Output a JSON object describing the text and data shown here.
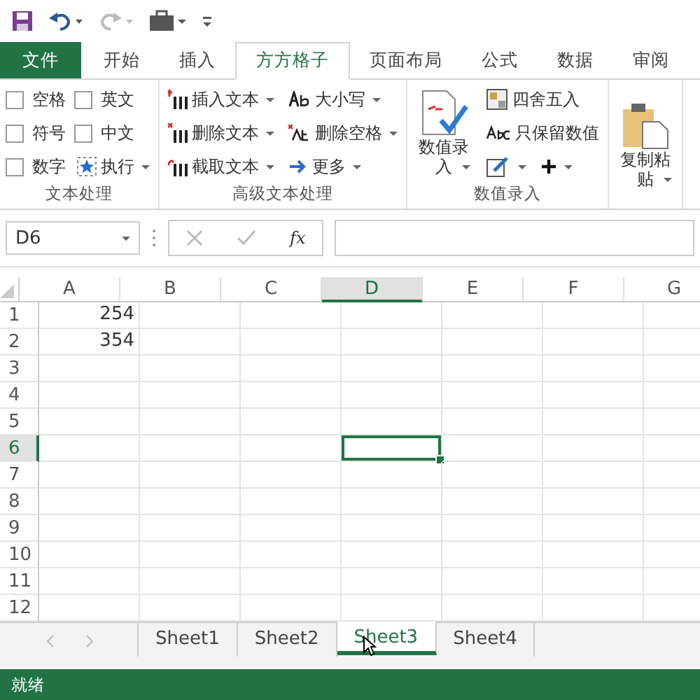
{
  "tabs": [
    {
      "label": "文件",
      "kind": "file",
      "selected": false
    },
    {
      "label": "开始",
      "kind": "tab",
      "selected": false
    },
    {
      "label": "插入",
      "kind": "tab",
      "selected": false
    },
    {
      "label": "方方格子",
      "kind": "tab",
      "selected": true
    },
    {
      "label": "页面布局",
      "kind": "tab",
      "selected": false
    },
    {
      "label": "公式",
      "kind": "tab",
      "selected": false
    },
    {
      "label": "数据",
      "kind": "tab",
      "selected": false
    },
    {
      "label": "审阅",
      "kind": "tab",
      "selected": false
    }
  ],
  "groups": [
    {
      "title": "文本处理",
      "columns": [
        [
          {
            "kind": "checkbox",
            "label": "空格",
            "checked": false
          },
          {
            "kind": "checkbox",
            "label": "符号",
            "checked": false
          },
          {
            "kind": "checkbox",
            "label": "数字",
            "checked": false
          }
        ],
        [
          {
            "kind": "checkbox",
            "label": "英文",
            "checked": false
          },
          {
            "kind": "checkbox",
            "label": "中文",
            "checked": false
          },
          {
            "kind": "button",
            "label": "执行",
            "dropdown": true
          }
        ]
      ]
    },
    {
      "title": "高级文本处理",
      "columns": [
        [
          {
            "kind": "button",
            "label": "插入文本",
            "dropdown": true
          },
          {
            "kind": "button",
            "label": "删除文本",
            "dropdown": true
          },
          {
            "kind": "button",
            "label": "截取文本",
            "dropdown": true
          }
        ],
        [
          {
            "kind": "button",
            "label": "大小写",
            "dropdown": true
          },
          {
            "kind": "button",
            "label": "删除空格",
            "dropdown": true
          },
          {
            "kind": "button",
            "label": "更多",
            "dropdown": true
          }
        ]
      ]
    },
    {
      "title": "数值录入",
      "columns": [
        [
          {
            "kind": "large",
            "label": "数值录入",
            "dropdown": true
          }
        ],
        [
          {
            "kind": "button",
            "label": "四舍五入",
            "dropdown": false
          },
          {
            "kind": "button",
            "label": "只保留数值",
            "dropdown": false
          },
          {
            "kind": "pair"
          }
        ]
      ]
    },
    {
      "columns": [
        [
          {
            "kind": "large",
            "label": "复制粘贴",
            "dropdown": true
          }
        ]
      ]
    }
  ],
  "formula_bar": {
    "name_box": "D6",
    "fx": "fx"
  },
  "sheet": {
    "columns": [
      {
        "label": "A",
        "selected": false
      },
      {
        "label": "B",
        "selected": false
      },
      {
        "label": "C",
        "selected": false
      },
      {
        "label": "D",
        "selected": true
      },
      {
        "label": "E",
        "selected": false
      },
      {
        "label": "F",
        "selected": false
      },
      {
        "label": "G",
        "selected": false
      }
    ],
    "rows": [
      {
        "label": "1",
        "selected": false,
        "cells": [
          "254"
        ]
      },
      {
        "label": "2",
        "selected": false,
        "cells": [
          "354"
        ]
      },
      {
        "label": "3",
        "selected": false
      },
      {
        "label": "4",
        "selected": false
      },
      {
        "label": "5",
        "selected": false
      },
      {
        "label": "6",
        "selected": true
      },
      {
        "label": "7",
        "selected": false
      },
      {
        "label": "8",
        "selected": false
      },
      {
        "label": "9",
        "selected": false
      },
      {
        "label": "10",
        "selected": false
      },
      {
        "label": "11",
        "selected": false
      },
      {
        "label": "12",
        "selected": false
      }
    ]
  },
  "sheet_tabs": [
    {
      "label": "Sheet1",
      "selected": false
    },
    {
      "label": "Sheet2",
      "selected": false
    },
    {
      "label": "Sheet3",
      "selected": true
    },
    {
      "label": "Sheet4",
      "selected": false
    }
  ],
  "status_bar": {
    "text": "就绪"
  }
}
